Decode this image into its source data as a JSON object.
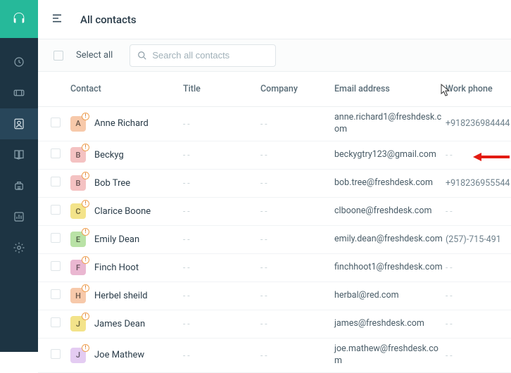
{
  "app": {
    "page_title": "All contacts"
  },
  "filter": {
    "select_all_label": "Select all",
    "search_placeholder": "Search all contacts"
  },
  "columns": {
    "contact": "Contact",
    "title": "Title",
    "company": "Company",
    "email": "Email address",
    "workphone": "Work phone"
  },
  "dash": "- -",
  "rows": [
    {
      "initial": "A",
      "color": "#f7c9aa",
      "name": "Anne Richard",
      "email": "anne.richard1@freshdesk.com",
      "phone": "+918236984444"
    },
    {
      "initial": "B",
      "color": "#f4c2c2",
      "name": "Beckyg",
      "email": "beckygtry123@gmail.com",
      "phone": "- -"
    },
    {
      "initial": "B",
      "color": "#f4c2c2",
      "name": "Bob Tree",
      "email": "bob.tree@freshdesk.com",
      "phone": "+918236955544"
    },
    {
      "initial": "C",
      "color": "#f3e38a",
      "name": "Clarice Boone",
      "email": "clboone@freshdesk.com",
      "phone": "- -"
    },
    {
      "initial": "E",
      "color": "#b9e2a6",
      "name": "Emily Dean",
      "email": "emily.dean@freshdesk.com",
      "phone": "(257)-715-491"
    },
    {
      "initial": "F",
      "color": "#eab7d1",
      "name": "Finch Hoot",
      "email": "finchhoot1@freshdesk.com",
      "phone": "- -"
    },
    {
      "initial": "H",
      "color": "#f7c9aa",
      "name": "Herbel sheild",
      "email": "herbal@red.com",
      "phone": "- -"
    },
    {
      "initial": "J",
      "color": "#f3e38a",
      "name": "James Dean",
      "email": "james@freshdesk.com",
      "phone": "- -"
    },
    {
      "initial": "J",
      "color": "#e4ccf2",
      "name": "Joe Mathew",
      "email": "joe.mathew@freshdesk.com",
      "phone": "- -"
    }
  ]
}
